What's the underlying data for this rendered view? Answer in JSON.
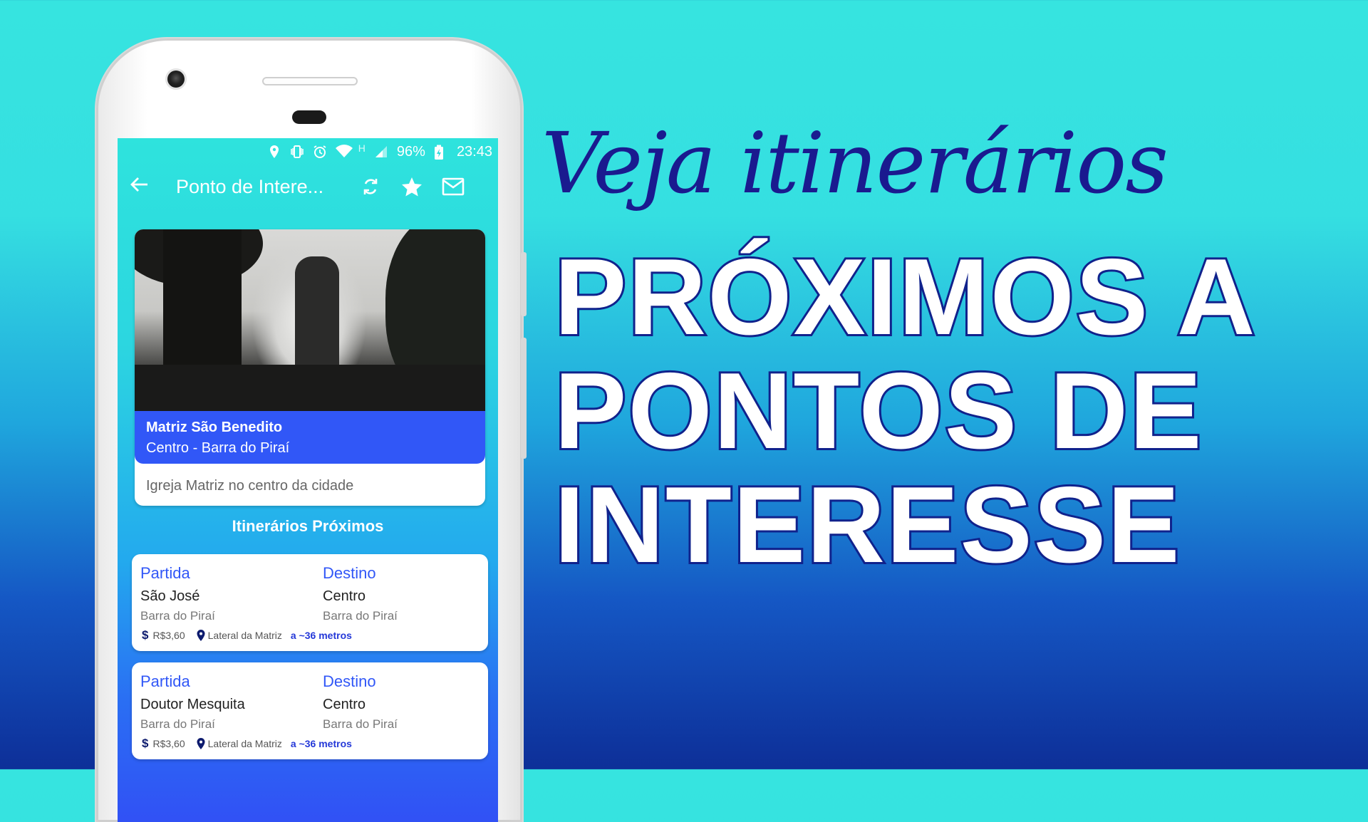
{
  "status_bar": {
    "battery": "96%",
    "time": "23:43",
    "network_letter": "H",
    "icons": [
      "location-icon",
      "vibrate-icon",
      "alarm-icon",
      "wifi-icon",
      "signal-icon",
      "battery-charging-icon"
    ]
  },
  "app_bar": {
    "title": "Ponto de Intere...",
    "icons": [
      "back-arrow-icon",
      "refresh-icon",
      "star-icon",
      "mail-icon"
    ]
  },
  "poi": {
    "name": "Matriz São Benedito",
    "area": "Centro - Barra do Piraí",
    "description": "Igreja Matriz no centro da cidade"
  },
  "section_title": "Itinerários Próximos",
  "itineraries": [
    {
      "from_label": "Partida",
      "from_place": "São José",
      "from_city": "Barra do Piraí",
      "to_label": "Destino",
      "to_place": "Centro",
      "to_city": "Barra do Piraí",
      "fare": "R$3,60",
      "stop": "Lateral da Matriz",
      "distance": "a ~36 metros"
    },
    {
      "from_label": "Partida",
      "from_place": "Doutor Mesquita",
      "from_city": "Barra do Piraí",
      "to_label": "Destino",
      "to_place": "Centro",
      "to_city": "Barra do Piraí",
      "fare": "R$3,60",
      "stop": "Lateral da Matriz",
      "distance": "a ~36 metros"
    }
  ],
  "headline": {
    "script_line": "Veja itinerários",
    "line1": "PRÓXIMOS A",
    "line2": "PONTOS DE",
    "line3": "INTERESSE"
  },
  "colors": {
    "accent_blue": "#3157f7",
    "headline_outline": "#10228c",
    "script_color": "#1a1a8f"
  }
}
